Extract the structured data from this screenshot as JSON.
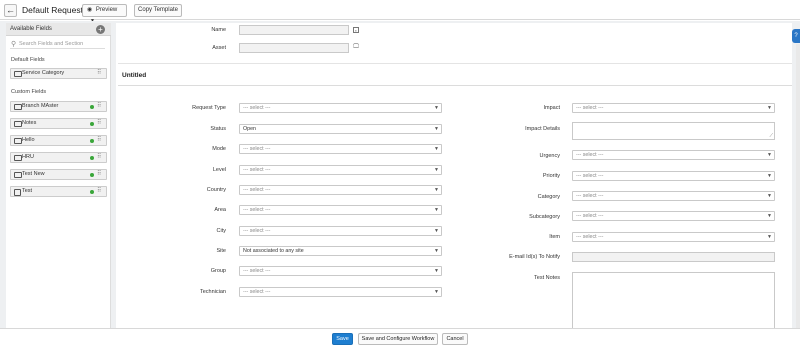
{
  "header": {
    "back_glyph": "←",
    "title": "Default Request",
    "preview_label": "Preview",
    "copy_template_label": "Copy Template"
  },
  "sidebar": {
    "title": "Available Fields",
    "search_placeholder": "Search Fields and Section",
    "default_section": "Default Fields",
    "default_fields": [
      {
        "label": "Service Category"
      }
    ],
    "custom_section": "Custom Fields",
    "custom_fields": [
      {
        "label": "Branch MAster",
        "active": true
      },
      {
        "label": "Notes",
        "active": true
      },
      {
        "label": "Hello",
        "active": true
      },
      {
        "label": "HRU",
        "active": true
      },
      {
        "label": "Test New",
        "active": true
      },
      {
        "label": "Test",
        "active": true
      }
    ]
  },
  "form": {
    "top_fields": [
      {
        "label": "Name",
        "icon": "contact-icon"
      },
      {
        "label": "Asset",
        "icon": "asset-icon"
      }
    ],
    "section_title": "Untitled",
    "left_fields": [
      {
        "label": "Request Type",
        "value": "--- select ---",
        "placeholder": true
      },
      {
        "label": "Status",
        "value": "Open",
        "placeholder": false
      },
      {
        "label": "Mode",
        "value": "--- select ---",
        "placeholder": true
      },
      {
        "label": "Level",
        "value": "--- select ---",
        "placeholder": true
      },
      {
        "label": "Country",
        "value": "--- select ---",
        "placeholder": true
      },
      {
        "label": "Area",
        "value": "--- select ---",
        "placeholder": true
      },
      {
        "label": "City",
        "value": "--- select ---",
        "placeholder": true
      },
      {
        "label": "Site",
        "value": "Not associated to any site",
        "placeholder": false
      },
      {
        "label": "Group",
        "value": "--- select ---",
        "placeholder": true
      },
      {
        "label": "Technician",
        "value": "--- select ---",
        "placeholder": true
      }
    ],
    "right_fields": [
      {
        "label": "Impact",
        "value": "--- select ---",
        "kind": "select"
      },
      {
        "label": "Impact Details",
        "value": "",
        "kind": "textarea"
      },
      {
        "label": "Urgency",
        "value": "--- select ---",
        "kind": "select"
      },
      {
        "label": "Priority",
        "value": "--- select ---",
        "kind": "select"
      },
      {
        "label": "Category",
        "value": "--- select ---",
        "kind": "select"
      },
      {
        "label": "Subcategory",
        "value": "--- select ---",
        "kind": "select"
      },
      {
        "label": "Item",
        "value": "--- select ---",
        "kind": "select"
      },
      {
        "label": "E-mail Id(s) To Notify",
        "value": "",
        "kind": "text"
      },
      {
        "label": "Test Notes",
        "value": "",
        "kind": "textarea-large"
      }
    ]
  },
  "footer": {
    "save_label": "Save",
    "save_config_label": "Save and Configure Workflow",
    "cancel_label": "Cancel"
  },
  "colors": {
    "accent": "#1e7ed0",
    "active_dot": "#3aa63a",
    "help_tab": "#2a76c6"
  }
}
